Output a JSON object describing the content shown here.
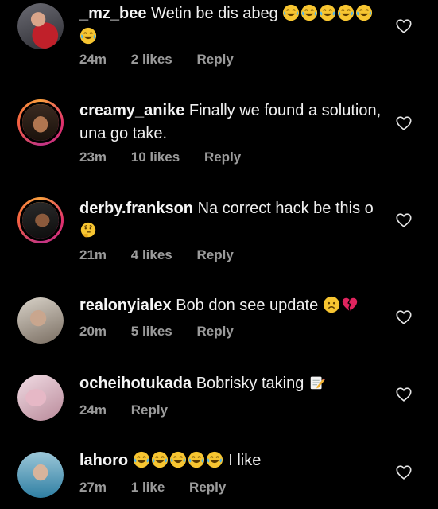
{
  "comments": [
    {
      "username": "_mz_bee",
      "text": "Wetin be dis abeg",
      "emojis": [
        "laugh-cry-emoji",
        "laugh-cry-emoji",
        "laugh-cry-emoji",
        "laugh-cry-emoji",
        "laugh-cry-emoji",
        "laugh-cry-emoji"
      ],
      "time": "24m",
      "likes": "2 likes",
      "reply": "Reply"
    },
    {
      "username": "creamy_anike",
      "text": "Finally we found a solution, una go take.",
      "time": "23m",
      "likes": "10 likes",
      "reply": "Reply"
    },
    {
      "username": "derby.frankson",
      "text": "Na correct hack be this o",
      "emojis": [
        "thinking-emoji"
      ],
      "time": "21m",
      "likes": "4 likes",
      "reply": "Reply"
    },
    {
      "username": "realonyialex",
      "text": "Bob don see update",
      "emojis": [
        "sad-face-emoji",
        "broken-heart-emoji"
      ],
      "time": "20m",
      "likes": "5 likes",
      "reply": "Reply"
    },
    {
      "username": "ocheihotukada",
      "text": "Bobrisky taking",
      "emojis": [
        "memo-emoji"
      ],
      "time": "24m",
      "reply": "Reply"
    },
    {
      "username": "lahoro",
      "text": "I like",
      "emojis": [
        "laugh-cry-emoji",
        "laugh-cry-emoji",
        "laugh-cry-emoji",
        "laugh-cry-emoji",
        "laugh-cry-emoji"
      ],
      "time": "27m",
      "likes": "1 like",
      "reply": "Reply"
    }
  ],
  "colors": {
    "background": "#000000",
    "text": "#f2f2f2",
    "meta": "#9b9b9b",
    "story_ring": "#e1306c"
  }
}
